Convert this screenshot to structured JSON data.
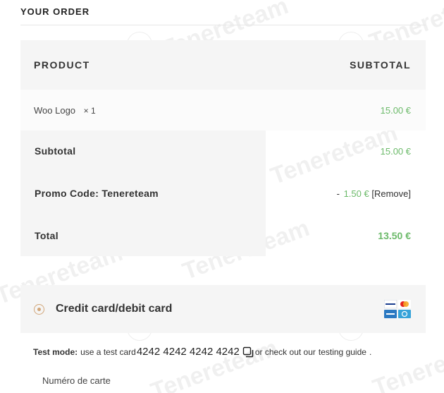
{
  "order": {
    "title": "YOUR ORDER",
    "columns": {
      "product": "PRODUCT",
      "subtotal": "SUBTOTAL"
    },
    "item": {
      "name": "Woo Logo",
      "qty": "× 1",
      "price": "15.00 €"
    },
    "subtotal": {
      "label": "Subtotal",
      "value": "15.00 €"
    },
    "promo": {
      "label": "Promo Code: Tenereteam",
      "minus": "-",
      "value": "1.50 €",
      "remove": "[Remove]"
    },
    "total": {
      "label": "Total",
      "value": "13.50 €"
    }
  },
  "payment": {
    "method_label": "Credit card/debit card",
    "icons": [
      "visa-icon",
      "mastercard-icon",
      "amex-icon",
      "diners-icon"
    ],
    "test_mode": {
      "prefix": "Test mode:",
      "text": "use a test card",
      "card_number": "4242 4242 4242 4242",
      "middle": "or check out our",
      "link": "testing guide",
      "suffix": "."
    },
    "card_field_label": "Numéro de carte"
  },
  "watermark": {
    "text": "Tenereteam"
  },
  "colors": {
    "accent_price": "#6cba6a",
    "radio": "#d2a679",
    "panel_bg": "#f5f5f5"
  }
}
